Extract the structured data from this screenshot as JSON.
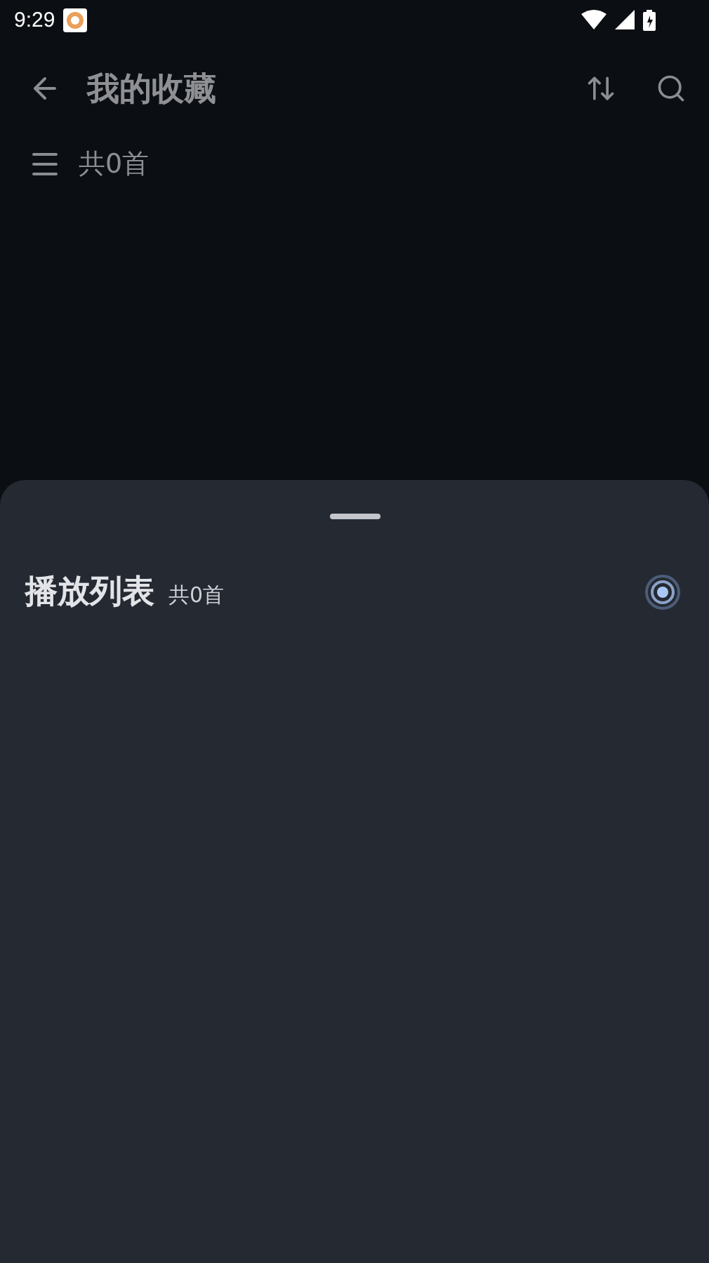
{
  "status_bar": {
    "time": "9:29"
  },
  "app_bar": {
    "title": "我的收藏"
  },
  "list_header": {
    "count": "共0首"
  },
  "sheet": {
    "title": "播放列表",
    "count": "共0首"
  }
}
